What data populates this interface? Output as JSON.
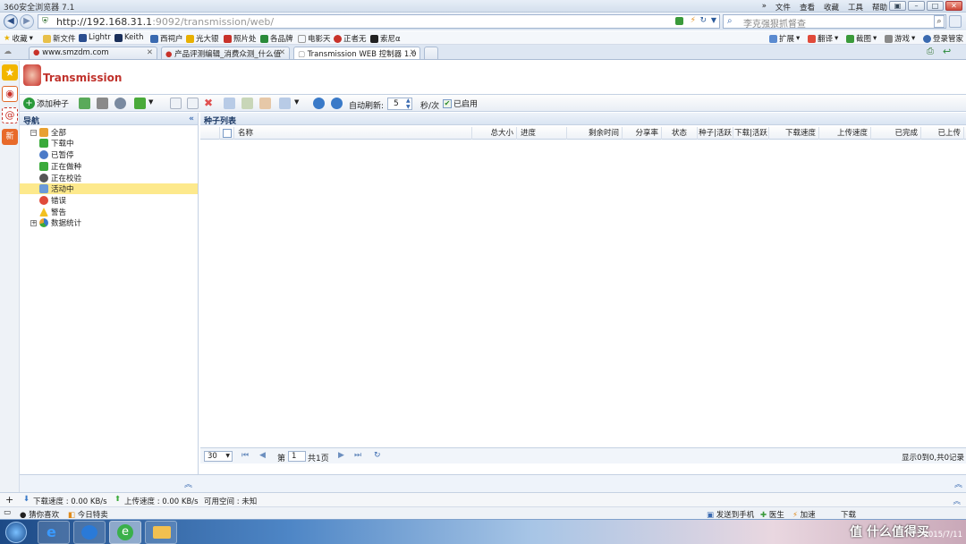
{
  "browser": {
    "title": "360安全浏览器 7.1",
    "menus": [
      "»",
      "文件",
      "查看",
      "收藏",
      "工具",
      "帮助"
    ],
    "url_host": "http://192.168.31.1",
    "url_rest": ":9092/transmission/web/",
    "search_placeholder": "李克强狠抓督查",
    "favorites": [
      "收藏",
      "新文件",
      "Lightr",
      "Keith",
      "西祠户",
      "光大银",
      "照片处",
      "各品牌",
      "电影天",
      "正者无",
      "索尼α"
    ],
    "right_tools": [
      "扩展",
      "翻译",
      "截图",
      "游戏",
      "登录管家"
    ],
    "tabs": [
      {
        "label": "www.smzdm.com"
      },
      {
        "label": "产品评测编辑_消费众测_什么值"
      },
      {
        "label": "Transmission WEB 控制器 1.0"
      }
    ]
  },
  "app": {
    "brand": "Transmission",
    "toolbar": {
      "add_torrent": "添加种子",
      "auto_refresh_label": "自动刷新:",
      "auto_refresh_value": "5",
      "auto_refresh_unit": "秒/次",
      "enabled_label": "已启用"
    },
    "nav": {
      "title": "导航",
      "collapse": "«",
      "items": [
        "全部",
        "下载中",
        "已暂停",
        "正在做种",
        "正在校验",
        "活动中",
        "错误",
        "警告",
        "数据统计"
      ]
    },
    "list": {
      "title": "种子列表",
      "columns": [
        "名称",
        "总大小",
        "进度",
        "剩余时间",
        "分享率",
        "状态",
        "种子|活跃",
        "下载|活跃",
        "下载速度",
        "上传速度",
        "已完成",
        "已上传"
      ]
    },
    "pager": {
      "page_size": "30",
      "page_prefix": "第",
      "page_value": "1",
      "page_total": "共1页",
      "record_info": "显示0到0,共0记录"
    },
    "status": {
      "download": "下载速度 : 0.00 KB/s",
      "upload": "上传速度 : 0.00 KB/s",
      "free_space": "可用空间 : 未知"
    }
  },
  "bottom": {
    "left": [
      "猜你喜欢",
      "今日特卖"
    ],
    "right": [
      "发送到手机",
      "医生",
      "加速",
      "下载"
    ]
  },
  "taskbar": {
    "watermark": "值 什么值得买",
    "date": "2015/7/11"
  }
}
